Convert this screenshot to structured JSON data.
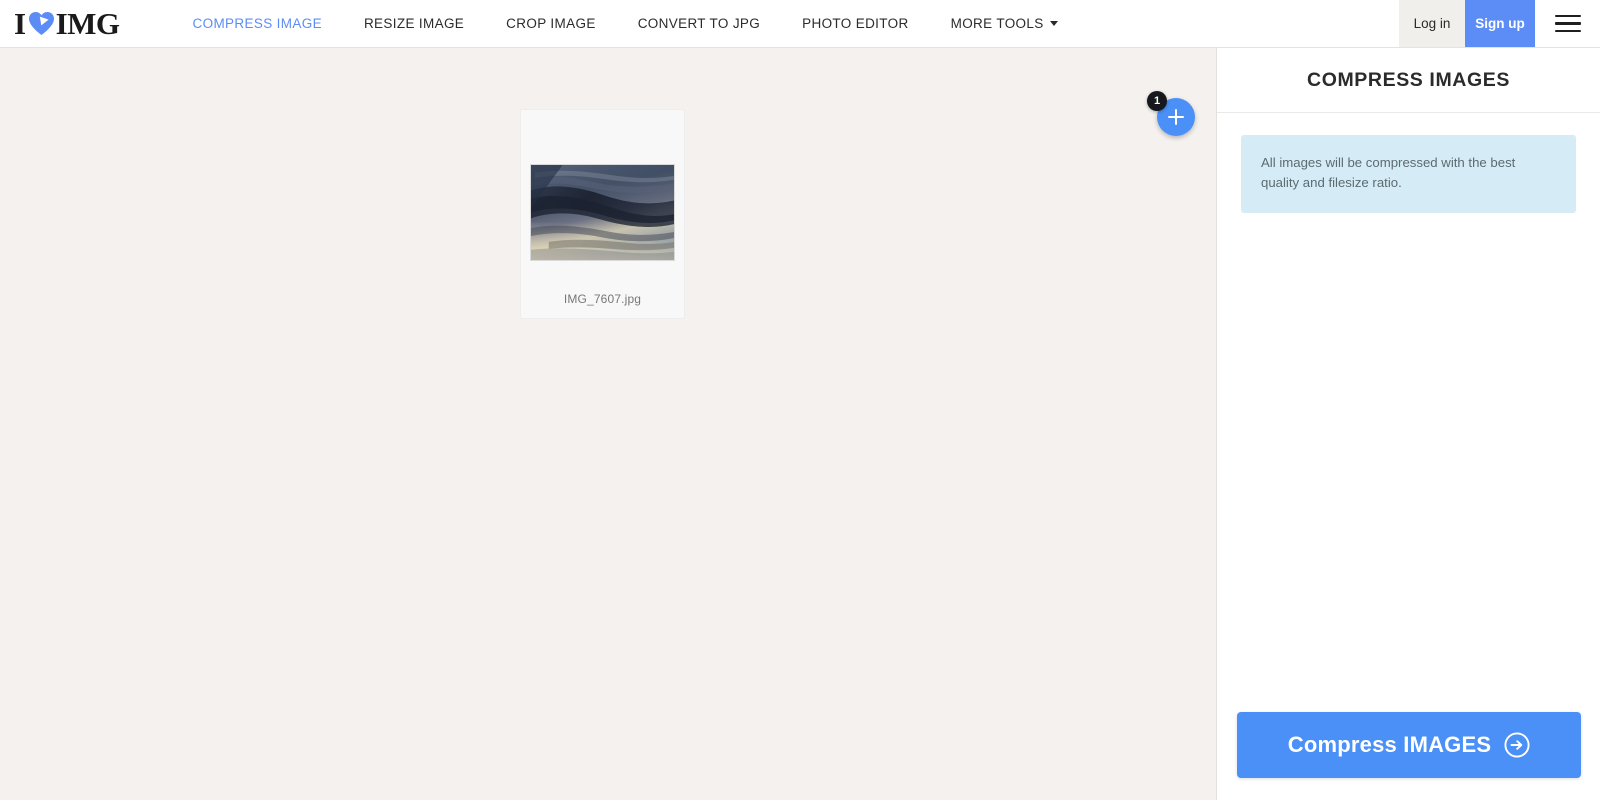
{
  "header": {
    "logo": {
      "left_text": "I",
      "right_text": "IMG",
      "heart_icon": "heart-play-icon",
      "heart_color": "#5c8df6"
    },
    "nav": [
      {
        "label": "COMPRESS IMAGE",
        "active": true
      },
      {
        "label": "RESIZE IMAGE",
        "active": false
      },
      {
        "label": "CROP IMAGE",
        "active": false
      },
      {
        "label": "CONVERT TO JPG",
        "active": false
      },
      {
        "label": "PHOTO EDITOR",
        "active": false
      },
      {
        "label": "MORE TOOLS",
        "active": false,
        "caret": true
      }
    ],
    "login_label": "Log in",
    "signup_label": "Sign up",
    "menu_icon": "hamburger-menu-icon"
  },
  "workspace": {
    "file": {
      "name": "IMG_7607.jpg",
      "thumbnail_alt": "dark storm clouds over a dusk sky"
    },
    "add_button": {
      "icon": "plus-icon",
      "badge_count": "1"
    }
  },
  "sidebar": {
    "title": "COMPRESS IMAGES",
    "info_text": "All images will be compressed with the best quality and filesize ratio.",
    "action_button": {
      "label": "Compress IMAGES",
      "icon": "arrow-right-circle-icon"
    }
  },
  "colors": {
    "accent_blue": "#4a90f7",
    "nav_active_blue": "#5c8df6",
    "page_background": "#f4f1ef",
    "panel_background": "#ffffff",
    "info_box_background": "#d5ecf6",
    "badge_background": "#16181d"
  }
}
